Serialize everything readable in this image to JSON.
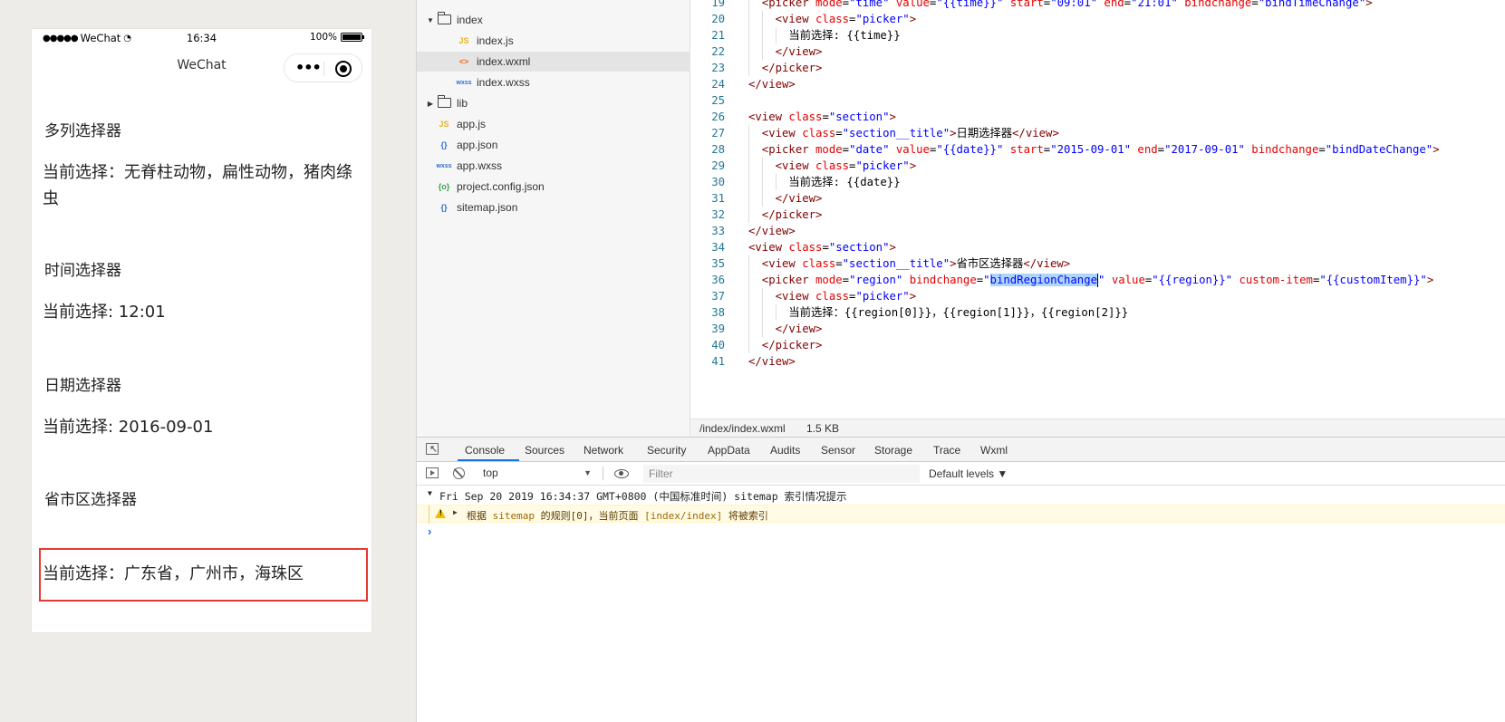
{
  "simulator": {
    "status_bar": {
      "carrier": "WeChat",
      "time": "16:34",
      "battery": "100%"
    },
    "nav_title": "WeChat",
    "sections": [
      {
        "title": "多列选择器",
        "value": "当前选择：无脊柱动物，扁性动物，猪肉绦虫"
      },
      {
        "title": "时间选择器",
        "value": "当前选择: 12:01"
      },
      {
        "title": "日期选择器",
        "value": "当前选择: 2016-09-01"
      },
      {
        "title": "省市区选择器",
        "value": "当前选择：广东省，广州市，海珠区"
      }
    ],
    "highlight_color": "#e53935"
  },
  "file_tree": [
    {
      "name": "index",
      "type": "folder",
      "expanded": true,
      "icon": "folder-icon"
    },
    {
      "name": "index.js",
      "type": "js",
      "icon": "JS"
    },
    {
      "name": "index.wxml",
      "type": "wxml",
      "icon": "<>",
      "selected": true
    },
    {
      "name": "index.wxss",
      "type": "wxss",
      "icon": "wxss"
    },
    {
      "name": "lib",
      "type": "folder",
      "expanded": false,
      "icon": "folder-icon"
    },
    {
      "name": "app.js",
      "type": "js",
      "icon": "JS"
    },
    {
      "name": "app.json",
      "type": "json",
      "icon": "{}"
    },
    {
      "name": "app.wxss",
      "type": "wxss",
      "icon": "wxss"
    },
    {
      "name": "project.config.json",
      "type": "config",
      "icon": "{o}"
    },
    {
      "name": "sitemap.json",
      "type": "json",
      "icon": "{}"
    }
  ],
  "editor": {
    "lines": [
      {
        "n": "19",
        "indent": 1,
        "code": "<picker mode=\"time\" value=\"{{time}}\" start=\"09:01\" end=\"21:01\" bindchange=\"bindTimeChange\">"
      },
      {
        "n": "20",
        "indent": 2,
        "code": "<view class=\"picker\">"
      },
      {
        "n": "21",
        "indent": 3,
        "code": "当前选择: {{time}}"
      },
      {
        "n": "22",
        "indent": 2,
        "code": "</view>"
      },
      {
        "n": "23",
        "indent": 1,
        "code": "</picker>"
      },
      {
        "n": "24",
        "indent": 0,
        "code": "</view>"
      },
      {
        "n": "25",
        "indent": 0,
        "code": ""
      },
      {
        "n": "26",
        "indent": 0,
        "code": "<view class=\"section\">"
      },
      {
        "n": "27",
        "indent": 1,
        "code": "<view class=\"section__title\">日期选择器</view>"
      },
      {
        "n": "28",
        "indent": 1,
        "code": "<picker mode=\"date\" value=\"{{date}}\" start=\"2015-09-01\" end=\"2017-09-01\" bindchange=\"bindDateChange\">"
      },
      {
        "n": "29",
        "indent": 2,
        "code": "<view class=\"picker\">"
      },
      {
        "n": "30",
        "indent": 3,
        "code": "当前选择: {{date}}"
      },
      {
        "n": "31",
        "indent": 2,
        "code": "</view>"
      },
      {
        "n": "32",
        "indent": 1,
        "code": "</picker>"
      },
      {
        "n": "33",
        "indent": 0,
        "code": "</view>"
      },
      {
        "n": "34",
        "indent": 0,
        "code": "<view class=\"section\">"
      },
      {
        "n": "35",
        "indent": 1,
        "code": "<view class=\"section__title\">省市区选择器</view>"
      },
      {
        "n": "36",
        "indent": 1,
        "code": "<picker mode=\"region\" bindchange=\"bindRegionChange\" value=\"{{region}}\" custom-item=\"{{customItem}}\">",
        "selected_word": "bindRegionChange"
      },
      {
        "n": "37",
        "indent": 2,
        "code": "<view class=\"picker\">"
      },
      {
        "n": "38",
        "indent": 3,
        "code": "当前选择：{{region[0]}}，{{region[1]}}，{{region[2]}}"
      },
      {
        "n": "39",
        "indent": 2,
        "code": "</view>"
      },
      {
        "n": "40",
        "indent": 1,
        "code": "</picker>"
      },
      {
        "n": "41",
        "indent": 0,
        "code": "</view>"
      }
    ],
    "status": {
      "path": "/index/index.wxml",
      "size": "1.5 KB"
    }
  },
  "devtools": {
    "tabs": [
      "Console",
      "Sources",
      "Network",
      "Security",
      "AppData",
      "Audits",
      "Sensor",
      "Storage",
      "Trace",
      "Wxml"
    ],
    "active_tab": "Console",
    "context": "top",
    "filter_placeholder": "Filter",
    "levels": "Default levels ▼",
    "group_message": "Fri Sep 20 2019 16:34:37 GMT+0800 (中国标准时间) sitemap 索引情况提示",
    "warning": {
      "p1": "根据 ",
      "k1": "sitemap",
      "p2": " 的规则[0]，当前页面 ",
      "k2": "[index/index]",
      "p3": " 将被索引"
    },
    "prompt": "›"
  }
}
